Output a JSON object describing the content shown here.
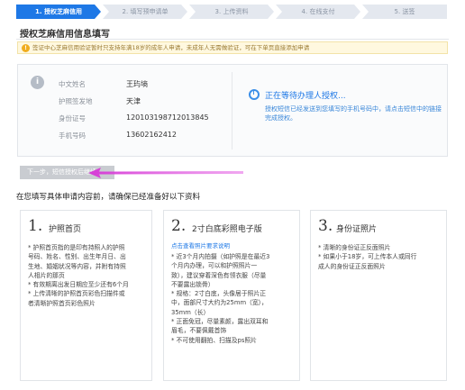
{
  "steps": [
    "1. 授权芝麻信用",
    "2. 填写预申请单",
    "3. 上传资料",
    "4. 在线支付",
    "5. 送签"
  ],
  "form_title": "授权芝麻信用信息填写",
  "notice": "签证中心芝麻信用验证暂时只支持年满18岁的成年人申请，未成年人无需做验证，可在下单页直接添加申请",
  "info": {
    "fields": [
      {
        "label": "中文姓名",
        "value": "王玙墒"
      },
      {
        "label": "护照签发地",
        "value": "天津"
      },
      {
        "label": "身份证号",
        "value": "120103198712013845"
      },
      {
        "label": "手机号码",
        "value": "13602162412"
      }
    ],
    "waiting_title": "正在等待办理人授权...",
    "waiting_desc": "授权短信已经发送到您填写的手机号码中，请点击短信中的链接完成授权。"
  },
  "next_button": "下一步，短信授权后继续",
  "intro": "在您填写具体申请内容前，请确保已经准备好以下资料",
  "cards": [
    {
      "num": "1.",
      "title": "护照首页",
      "link": "",
      "lines": [
        "* 护照首页指的是印有持照人的护照",
        "号码、姓名、性别、出生年月日、出",
        "生地、婚姻状况等内容，并附有持照",
        "人相片的那页",
        "* 有效期离出发日期应至少还有6个月",
        "* 上传清晰的护照首页彩色扫描件或",
        "者清晰护照首页彩色照片"
      ]
    },
    {
      "num": "2.",
      "title": "2寸白底彩照电子版",
      "link": "点击查看照片要求说明",
      "lines": [
        "* 近3个月内拍摄（如护照是在最近3",
        "个月内办理，可以和护照照片一",
        "致），建议穿着深色有领衣服（尽量",
        "不要露出锁骨）",
        "* 规格：2寸白底，头像居于照片正",
        "中，面部尺寸大约为25mm（宽），",
        "35mm（长）",
        "* 正面免冠，尽量素颜，露出双耳和",
        "眉毛，不要佩戴首饰",
        "* 不可使用翻拍、扫描及ps照片"
      ]
    },
    {
      "num": "3.",
      "title": "身份证照片",
      "link": "",
      "lines": [
        "* 清晰的身份证正反面照片",
        "* 如果小于18岁，可上传本人或同行",
        "成人的身份证正反面照片"
      ]
    }
  ]
}
